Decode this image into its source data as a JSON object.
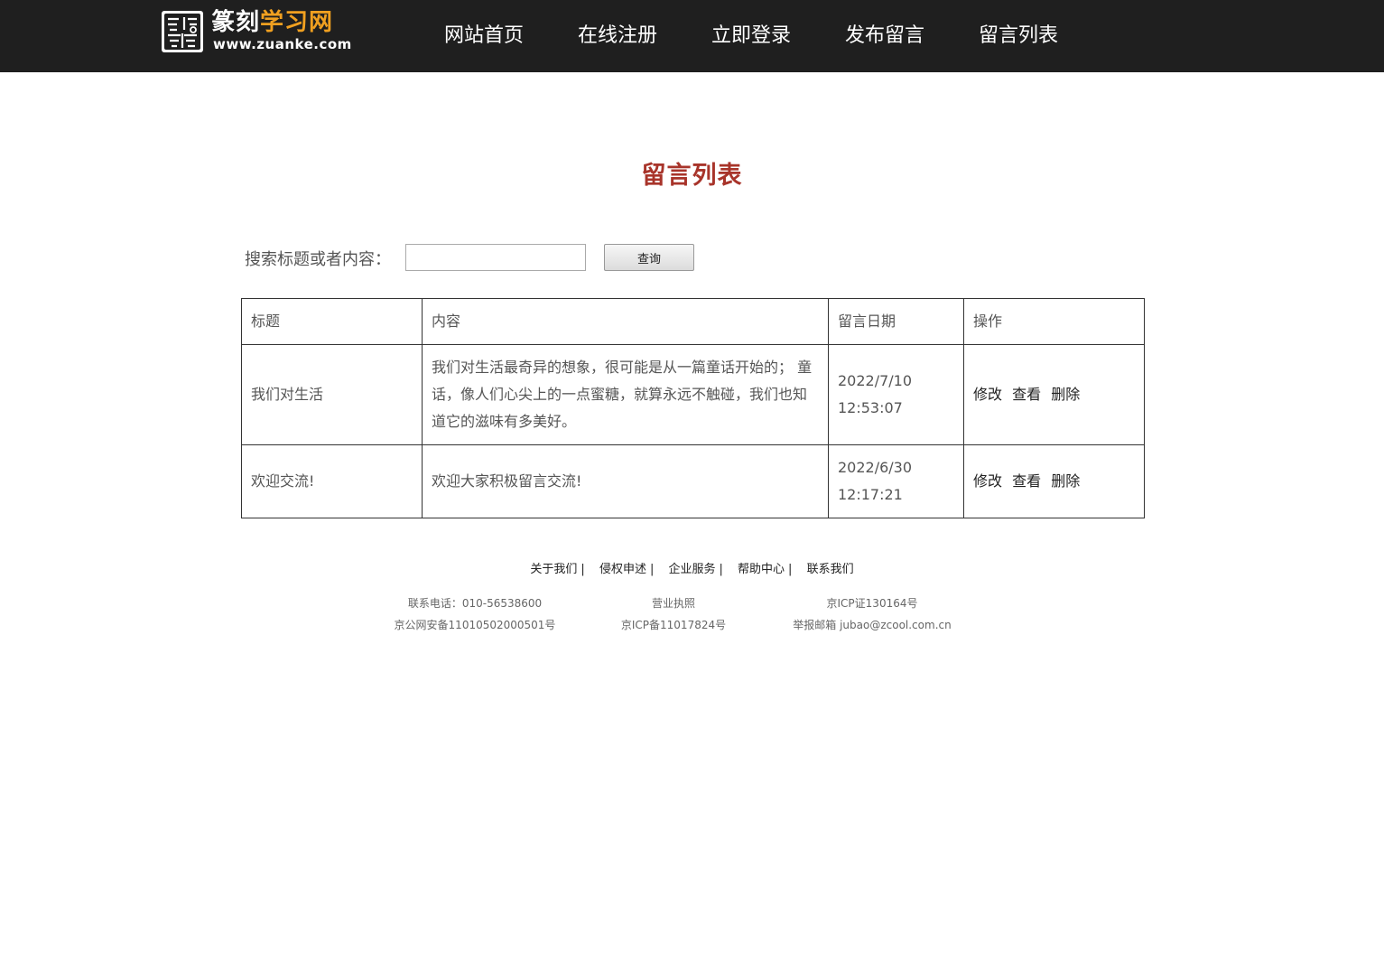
{
  "header": {
    "logo_name_part1": "篆刻",
    "logo_name_part2": "学习网",
    "logo_url": "www.zuanke.com",
    "accent_color": "#f0a020",
    "nav": [
      "网站首页",
      "在线注册",
      "立即登录",
      "发布留言",
      "留言列表"
    ]
  },
  "main": {
    "title": "留言列表",
    "title_color": "#a8342a",
    "search_label": "搜索标题或者内容：",
    "search_value": "",
    "search_button": "查询"
  },
  "table": {
    "headers": [
      "标题",
      "内容",
      "留言日期",
      "操作"
    ],
    "rows": [
      {
        "title": "我们对生活",
        "content": "我们对生活最奇异的想象，很可能是从一篇童话开始的； 童话，像人们心尖上的一点蜜糖，就算永远不触碰，我们也知道它的滋味有多美好。",
        "date": "2022/7/10 12:53:07",
        "actions": [
          "修改",
          "查看",
          "删除"
        ]
      },
      {
        "title": "欢迎交流!",
        "content": "欢迎大家积极留言交流!",
        "date": "2022/6/30 12:17:21",
        "actions": [
          "修改",
          "查看",
          "删除"
        ]
      }
    ]
  },
  "footer": {
    "links": [
      "关于我们",
      "侵权申述",
      "企业服务",
      "帮助中心",
      "联系我们"
    ],
    "separator": "|",
    "info": [
      "联系电话：010-56538600",
      "营业执照",
      "京ICP证130164号",
      "京公网安备11010502000501号",
      "京ICP备11017824号",
      "举报邮箱 jubao@zcool.com.cn"
    ]
  }
}
